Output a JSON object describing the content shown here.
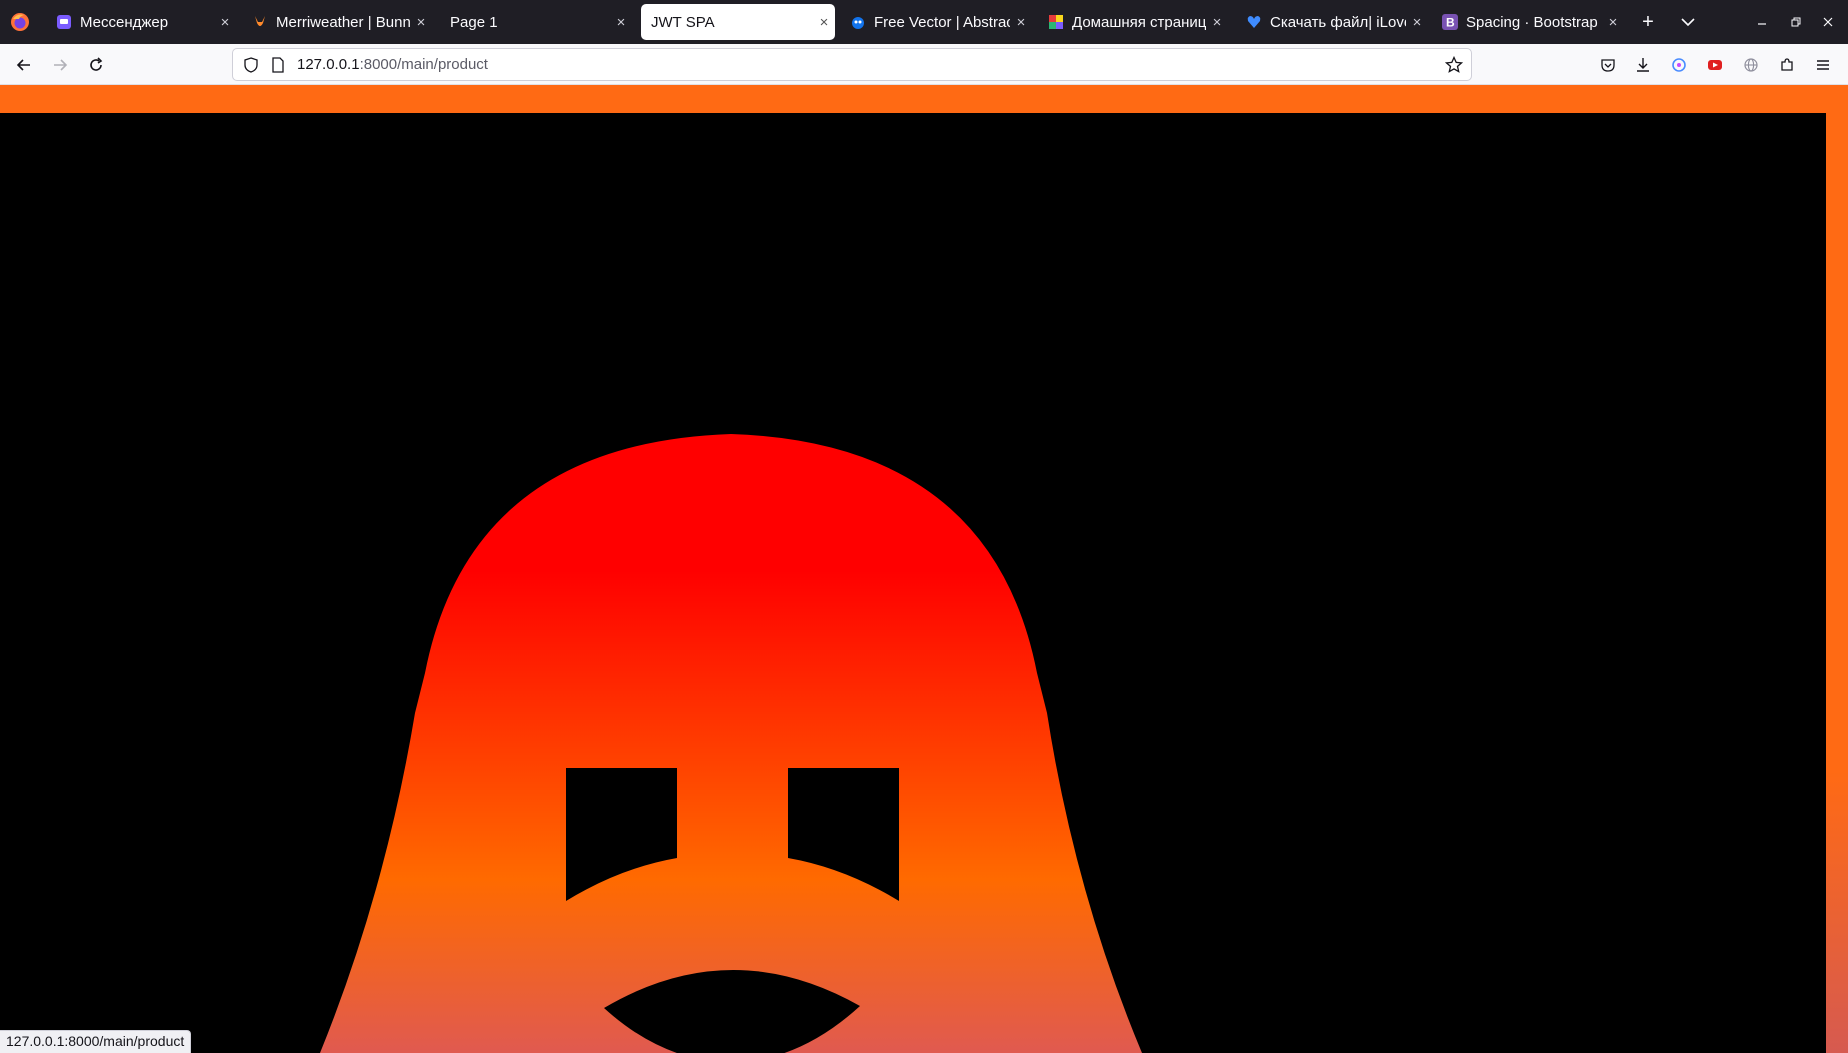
{
  "tabs": [
    {
      "title": "Мессенджер",
      "favicon": "chat-icon",
      "color": "#7b5cff"
    },
    {
      "title": "Merriweather | Bunny",
      "favicon": "bunny-icon",
      "color": "#ff8a2b"
    },
    {
      "title": "Page 1",
      "favicon": "",
      "color": ""
    },
    {
      "title": "JWT SPA",
      "favicon": "",
      "color": "",
      "active": true
    },
    {
      "title": "Free Vector | Abstract",
      "favicon": "freepik-icon",
      "color": "#1273eb"
    },
    {
      "title": "Домашняя страница",
      "favicon": "grid-color-icon",
      "color": "#e63b3b"
    },
    {
      "title": "Скачать файл| iLovePDF",
      "favicon": "heart-icon",
      "color": "#3f8cff"
    },
    {
      "title": "Spacing · Bootstrap",
      "favicon": "bootstrap-icon",
      "color": "#7952b3"
    }
  ],
  "nav": {
    "url_host": "127.0.0.1",
    "url_rest": ":8000/main/product"
  },
  "status_bar": "127.0.0.1:8000/main/product",
  "colors": {
    "accent_orange": "#ff6a14",
    "ghost_top": "#ff0000",
    "ghost_mid": "#ff6a00",
    "ghost_bottom": "#e05a50"
  },
  "icons": {
    "new_tab": "+",
    "tab_list": "⌄",
    "close": "×"
  }
}
